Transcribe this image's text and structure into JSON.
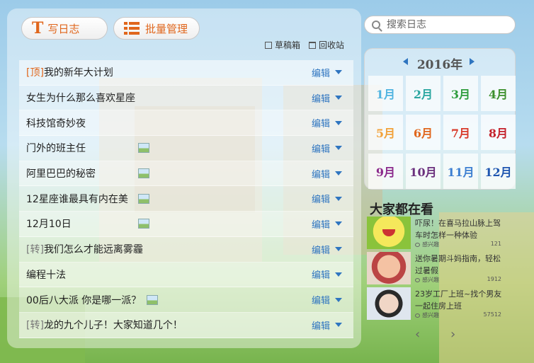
{
  "toolbar": {
    "write_label": "写日志",
    "write_icon_glyph": "T",
    "batch_label": "批量管理",
    "draft_label": "草稿箱",
    "trash_label": "回收站"
  },
  "posts": [
    {
      "tag": "[顶]",
      "tag_style": "orange",
      "title": "我的新年大计划",
      "has_image": false,
      "edit_label": "编辑"
    },
    {
      "tag": "",
      "tag_style": "",
      "title": "女生为什么那么喜欢星座",
      "has_image": false,
      "edit_label": "编辑"
    },
    {
      "tag": "",
      "tag_style": "",
      "title": "科技馆奇妙夜",
      "has_image": false,
      "edit_label": "编辑"
    },
    {
      "tag": "",
      "tag_style": "",
      "title": "门外的班主任",
      "has_image": true,
      "edit_label": "编辑"
    },
    {
      "tag": "",
      "tag_style": "",
      "title": " 阿里巴巴的秘密",
      "has_image": true,
      "edit_label": "编辑"
    },
    {
      "tag": "",
      "tag_style": "",
      "title": "12星座谁最具有内在美",
      "has_image": true,
      "edit_label": "编辑"
    },
    {
      "tag": "",
      "tag_style": "",
      "title": "12月10日",
      "has_image": true,
      "edit_label": "编辑"
    },
    {
      "tag": "[转]",
      "tag_style": "gray",
      "title": "我们怎么才能远离雾霾",
      "has_image": false,
      "edit_label": "编辑"
    },
    {
      "tag": "",
      "tag_style": "",
      "title": "编程十法",
      "has_image": false,
      "edit_label": "编辑"
    },
    {
      "tag": "",
      "tag_style": "",
      "title": "00后八大派 你是哪一派？",
      "has_image": true,
      "edit_label": "编辑"
    },
    {
      "tag": "[转]",
      "tag_style": "gray",
      "title": "龙的九个儿子！大家知道几个！",
      "has_image": false,
      "edit_label": "编辑"
    }
  ],
  "search": {
    "placeholder": "搜索日志"
  },
  "calendar": {
    "year_label": "2016年",
    "months": [
      {
        "label": "1月",
        "color": "#4fb3e0"
      },
      {
        "label": "2月",
        "color": "#2aa6a0"
      },
      {
        "label": "3月",
        "color": "#2f9d3d"
      },
      {
        "label": "4月",
        "color": "#3c8f2c"
      },
      {
        "label": "5月",
        "color": "#f2a23a"
      },
      {
        "label": "6月",
        "color": "#e0661c"
      },
      {
        "label": "7月",
        "color": "#d83a2a"
      },
      {
        "label": "8月",
        "color": "#c4202a"
      },
      {
        "label": "9月",
        "color": "#8b2a8c"
      },
      {
        "label": "10月",
        "color": "#6a2f7d"
      },
      {
        "label": "11月",
        "color": "#3d7fd1"
      },
      {
        "label": "12月",
        "color": "#1e55b0"
      }
    ]
  },
  "popular": {
    "title": "大家都在看",
    "items": [
      {
        "text": "吓尿！在喜马拉山脉上驾车时怎样一种体验",
        "label": "感兴趣",
        "count": "121"
      },
      {
        "text": "送你暑期斗妈指南，轻松过暑假",
        "label": "感兴趣",
        "count": "1912"
      },
      {
        "text": "23岁工厂上班~找个男友一起住房上班",
        "label": "感兴趣",
        "count": "57512"
      }
    ],
    "prev_glyph": "‹",
    "next_glyph": "›"
  }
}
